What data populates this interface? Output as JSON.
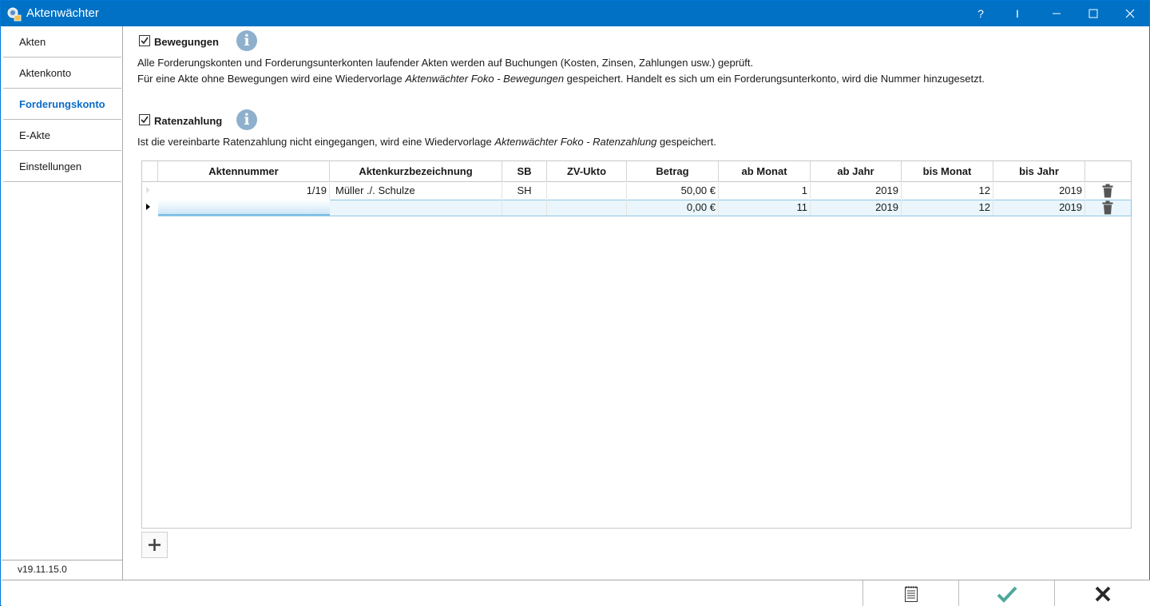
{
  "window": {
    "title": "Aktenwächter"
  },
  "titlebar_buttons": {
    "help": "?",
    "cursor": "I"
  },
  "sidebar": {
    "items": [
      {
        "label": "Akten"
      },
      {
        "label": "Aktenkonto"
      },
      {
        "label": "Forderungskonto",
        "active": true
      },
      {
        "label": "E-Akte"
      },
      {
        "label": "Einstellungen"
      }
    ],
    "version": "v19.11.15.0"
  },
  "bewegungen": {
    "checked": true,
    "label": "Bewegungen",
    "line1": "Alle Forderungskonten und Forderungsunterkonten laufender Akten werden auf Buchungen (Kosten, Zinsen, Zahlungen usw.) geprüft.",
    "line2_pre": "Für eine Akte ohne Bewegungen wird eine Wiedervorlage ",
    "line2_italic": "Aktenwächter Foko - Bewegungen",
    "line2_post": " gespeichert. Handelt es sich um ein Forderungsunterkonto, wird die Nummer hinzugesetzt."
  },
  "ratenzahlung": {
    "checked": true,
    "label": "Ratenzahlung",
    "line1_pre": "Ist die vereinbarte Ratenzahlung nicht eingegangen, wird eine Wiedervorlage ",
    "line1_italic": "Aktenwächter Foko - Ratenzahlung",
    "line1_post": " gespeichert."
  },
  "table": {
    "columns": [
      "Aktennummer",
      "Aktenkurzbezeichnung",
      "SB",
      "ZV-Ukto",
      "Betrag",
      "ab Monat",
      "ab Jahr",
      "bis Monat",
      "bis Jahr"
    ],
    "rows": [
      {
        "aktennummer": "1/19",
        "bezeichnung": "Müller ./. Schulze",
        "sb": "SH",
        "zv_ukto": "",
        "betrag": "50,00 €",
        "ab_monat": "1",
        "ab_jahr": "2019",
        "bis_monat": "12",
        "bis_jahr": "2019"
      },
      {
        "aktennummer": "",
        "bezeichnung": "",
        "sb": "",
        "zv_ukto": "",
        "betrag": "0,00 €",
        "ab_monat": "11",
        "ab_jahr": "2019",
        "bis_monat": "12",
        "bis_jahr": "2019"
      }
    ]
  },
  "icons": {
    "add": "plus-icon",
    "delete": "trash-icon",
    "info": "info-icon",
    "report": "list-document-icon",
    "ok": "checkmark-icon",
    "cancel": "close-x-icon"
  },
  "colors": {
    "titlebar": "#0071c5",
    "active_nav": "#0b6cc9",
    "ok_green": "#4fa89a",
    "info_blue": "#8fb0cc"
  }
}
